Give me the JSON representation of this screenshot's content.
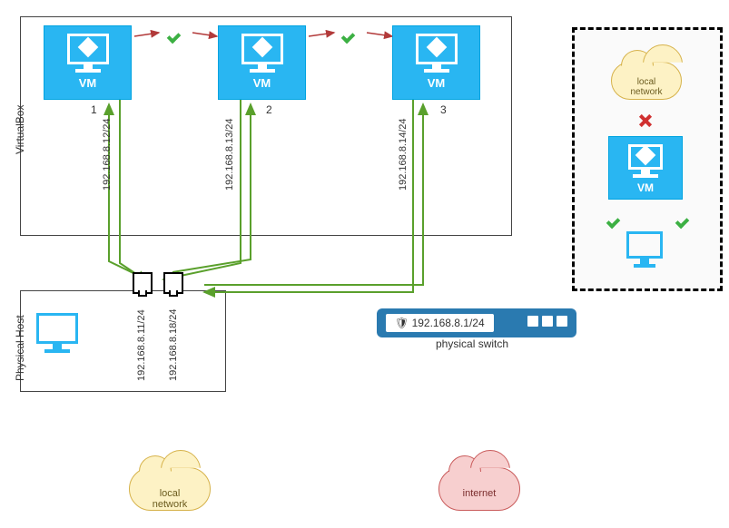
{
  "containers": {
    "virtualbox_label": "VirtualBox",
    "physical_host_label": "Physical Host"
  },
  "vms": [
    {
      "label": "VM",
      "num": "1",
      "ip": "192.168.8.12/24"
    },
    {
      "label": "VM",
      "num": "2",
      "ip": "192.168.8.13/24"
    },
    {
      "label": "VM",
      "num": "3",
      "ip": "192.168.8.14/24"
    }
  ],
  "host": {
    "nic1_ip": "192.168.8.11/24",
    "nic2_ip": "192.168.8.18/24"
  },
  "switch": {
    "ip": "192.168.8.1/24",
    "label": "physical switch"
  },
  "clouds": {
    "local": "local\nnetwork",
    "internet": "internet",
    "side_local": "local\nnetwork"
  },
  "side_panel": {
    "vm_label": "VM"
  },
  "colors": {
    "vm_bg": "#29b6f2",
    "switch_bg": "#2a7ab0",
    "link_green": "#5aa02c",
    "link_red": "#b23a3a",
    "cloud_yellow": "#fdf2c5",
    "cloud_red": "#f7cfcf"
  }
}
